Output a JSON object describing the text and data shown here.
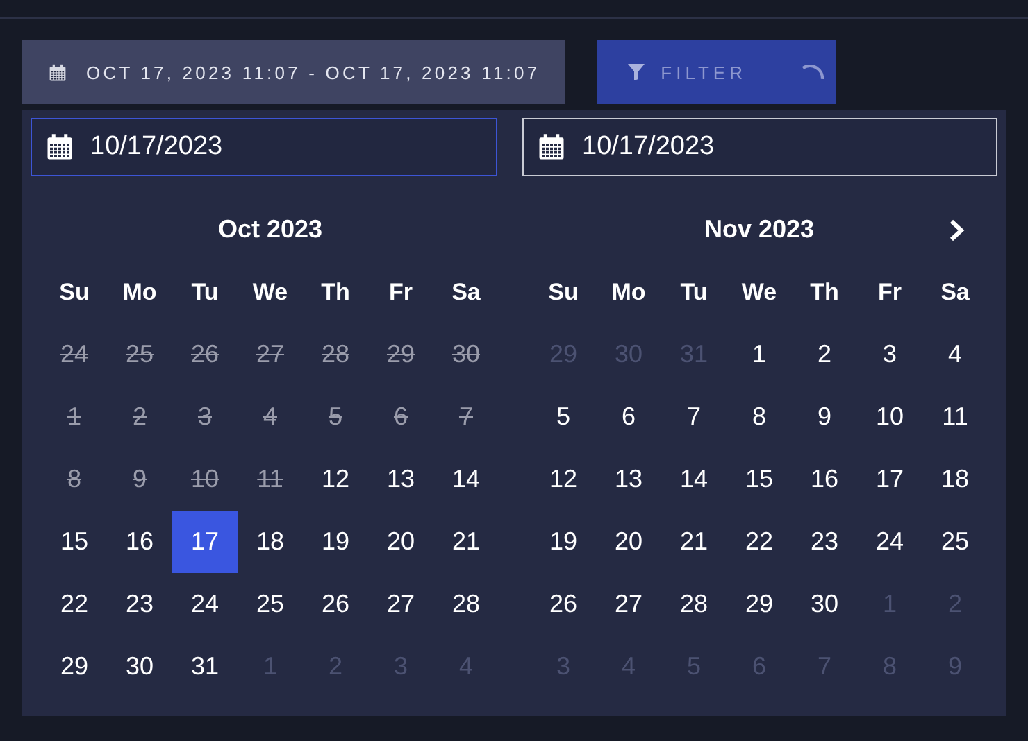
{
  "date_range_button": {
    "label": "OCT 17, 2023 11:07 - OCT 17, 2023 11:07"
  },
  "filter_button": {
    "label": "FILTER",
    "loading": true
  },
  "date_inputs": [
    {
      "value": "10/17/2023",
      "focused": true
    },
    {
      "value": "10/17/2023",
      "focused": false
    }
  ],
  "calendars": [
    {
      "title": "Oct 2023",
      "next_arrow": false,
      "weekdays": [
        "Su",
        "Mo",
        "Tu",
        "We",
        "Th",
        "Fr",
        "Sa"
      ],
      "days": [
        {
          "day": "24",
          "disabled": true,
          "outside": true,
          "selected": false
        },
        {
          "day": "25",
          "disabled": true,
          "outside": true,
          "selected": false
        },
        {
          "day": "26",
          "disabled": true,
          "outside": true,
          "selected": false
        },
        {
          "day": "27",
          "disabled": true,
          "outside": true,
          "selected": false
        },
        {
          "day": "28",
          "disabled": true,
          "outside": true,
          "selected": false
        },
        {
          "day": "29",
          "disabled": true,
          "outside": true,
          "selected": false
        },
        {
          "day": "30",
          "disabled": true,
          "outside": true,
          "selected": false
        },
        {
          "day": "1",
          "disabled": true,
          "outside": false,
          "selected": false
        },
        {
          "day": "2",
          "disabled": true,
          "outside": false,
          "selected": false
        },
        {
          "day": "3",
          "disabled": true,
          "outside": false,
          "selected": false
        },
        {
          "day": "4",
          "disabled": true,
          "outside": false,
          "selected": false
        },
        {
          "day": "5",
          "disabled": true,
          "outside": false,
          "selected": false
        },
        {
          "day": "6",
          "disabled": true,
          "outside": false,
          "selected": false
        },
        {
          "day": "7",
          "disabled": true,
          "outside": false,
          "selected": false
        },
        {
          "day": "8",
          "disabled": true,
          "outside": false,
          "selected": false
        },
        {
          "day": "9",
          "disabled": true,
          "outside": false,
          "selected": false
        },
        {
          "day": "10",
          "disabled": true,
          "outside": false,
          "selected": false
        },
        {
          "day": "11",
          "disabled": true,
          "outside": false,
          "selected": false
        },
        {
          "day": "12",
          "disabled": false,
          "outside": false,
          "selected": false
        },
        {
          "day": "13",
          "disabled": false,
          "outside": false,
          "selected": false
        },
        {
          "day": "14",
          "disabled": false,
          "outside": false,
          "selected": false
        },
        {
          "day": "15",
          "disabled": false,
          "outside": false,
          "selected": false
        },
        {
          "day": "16",
          "disabled": false,
          "outside": false,
          "selected": false
        },
        {
          "day": "17",
          "disabled": false,
          "outside": false,
          "selected": true
        },
        {
          "day": "18",
          "disabled": false,
          "outside": false,
          "selected": false
        },
        {
          "day": "19",
          "disabled": false,
          "outside": false,
          "selected": false
        },
        {
          "day": "20",
          "disabled": false,
          "outside": false,
          "selected": false
        },
        {
          "day": "21",
          "disabled": false,
          "outside": false,
          "selected": false
        },
        {
          "day": "22",
          "disabled": false,
          "outside": false,
          "selected": false
        },
        {
          "day": "23",
          "disabled": false,
          "outside": false,
          "selected": false
        },
        {
          "day": "24",
          "disabled": false,
          "outside": false,
          "selected": false
        },
        {
          "day": "25",
          "disabled": false,
          "outside": false,
          "selected": false
        },
        {
          "day": "26",
          "disabled": false,
          "outside": false,
          "selected": false
        },
        {
          "day": "27",
          "disabled": false,
          "outside": false,
          "selected": false
        },
        {
          "day": "28",
          "disabled": false,
          "outside": false,
          "selected": false
        },
        {
          "day": "29",
          "disabled": false,
          "outside": false,
          "selected": false
        },
        {
          "day": "30",
          "disabled": false,
          "outside": false,
          "selected": false
        },
        {
          "day": "31",
          "disabled": false,
          "outside": false,
          "selected": false
        },
        {
          "day": "1",
          "disabled": false,
          "outside": true,
          "selected": false
        },
        {
          "day": "2",
          "disabled": false,
          "outside": true,
          "selected": false
        },
        {
          "day": "3",
          "disabled": false,
          "outside": true,
          "selected": false
        },
        {
          "day": "4",
          "disabled": false,
          "outside": true,
          "selected": false
        }
      ]
    },
    {
      "title": "Nov 2023",
      "next_arrow": true,
      "weekdays": [
        "Su",
        "Mo",
        "Tu",
        "We",
        "Th",
        "Fr",
        "Sa"
      ],
      "days": [
        {
          "day": "29",
          "disabled": false,
          "outside": true,
          "selected": false
        },
        {
          "day": "30",
          "disabled": false,
          "outside": true,
          "selected": false
        },
        {
          "day": "31",
          "disabled": false,
          "outside": true,
          "selected": false
        },
        {
          "day": "1",
          "disabled": false,
          "outside": false,
          "selected": false
        },
        {
          "day": "2",
          "disabled": false,
          "outside": false,
          "selected": false
        },
        {
          "day": "3",
          "disabled": false,
          "outside": false,
          "selected": false
        },
        {
          "day": "4",
          "disabled": false,
          "outside": false,
          "selected": false
        },
        {
          "day": "5",
          "disabled": false,
          "outside": false,
          "selected": false
        },
        {
          "day": "6",
          "disabled": false,
          "outside": false,
          "selected": false
        },
        {
          "day": "7",
          "disabled": false,
          "outside": false,
          "selected": false
        },
        {
          "day": "8",
          "disabled": false,
          "outside": false,
          "selected": false
        },
        {
          "day": "9",
          "disabled": false,
          "outside": false,
          "selected": false
        },
        {
          "day": "10",
          "disabled": false,
          "outside": false,
          "selected": false
        },
        {
          "day": "11",
          "disabled": false,
          "outside": false,
          "selected": false
        },
        {
          "day": "12",
          "disabled": false,
          "outside": false,
          "selected": false
        },
        {
          "day": "13",
          "disabled": false,
          "outside": false,
          "selected": false
        },
        {
          "day": "14",
          "disabled": false,
          "outside": false,
          "selected": false
        },
        {
          "day": "15",
          "disabled": false,
          "outside": false,
          "selected": false
        },
        {
          "day": "16",
          "disabled": false,
          "outside": false,
          "selected": false
        },
        {
          "day": "17",
          "disabled": false,
          "outside": false,
          "selected": false
        },
        {
          "day": "18",
          "disabled": false,
          "outside": false,
          "selected": false
        },
        {
          "day": "19",
          "disabled": false,
          "outside": false,
          "selected": false
        },
        {
          "day": "20",
          "disabled": false,
          "outside": false,
          "selected": false
        },
        {
          "day": "21",
          "disabled": false,
          "outside": false,
          "selected": false
        },
        {
          "day": "22",
          "disabled": false,
          "outside": false,
          "selected": false
        },
        {
          "day": "23",
          "disabled": false,
          "outside": false,
          "selected": false
        },
        {
          "day": "24",
          "disabled": false,
          "outside": false,
          "selected": false
        },
        {
          "day": "25",
          "disabled": false,
          "outside": false,
          "selected": false
        },
        {
          "day": "26",
          "disabled": false,
          "outside": false,
          "selected": false
        },
        {
          "day": "27",
          "disabled": false,
          "outside": false,
          "selected": false
        },
        {
          "day": "28",
          "disabled": false,
          "outside": false,
          "selected": false
        },
        {
          "day": "29",
          "disabled": false,
          "outside": false,
          "selected": false
        },
        {
          "day": "30",
          "disabled": false,
          "outside": false,
          "selected": false
        },
        {
          "day": "1",
          "disabled": false,
          "outside": true,
          "selected": false
        },
        {
          "day": "2",
          "disabled": false,
          "outside": true,
          "selected": false
        },
        {
          "day": "3",
          "disabled": false,
          "outside": true,
          "selected": false
        },
        {
          "day": "4",
          "disabled": false,
          "outside": true,
          "selected": false
        },
        {
          "day": "5",
          "disabled": false,
          "outside": true,
          "selected": false
        },
        {
          "day": "6",
          "disabled": false,
          "outside": true,
          "selected": false
        },
        {
          "day": "7",
          "disabled": false,
          "outside": true,
          "selected": false
        },
        {
          "day": "8",
          "disabled": false,
          "outside": true,
          "selected": false
        },
        {
          "day": "9",
          "disabled": false,
          "outside": true,
          "selected": false
        }
      ]
    }
  ]
}
